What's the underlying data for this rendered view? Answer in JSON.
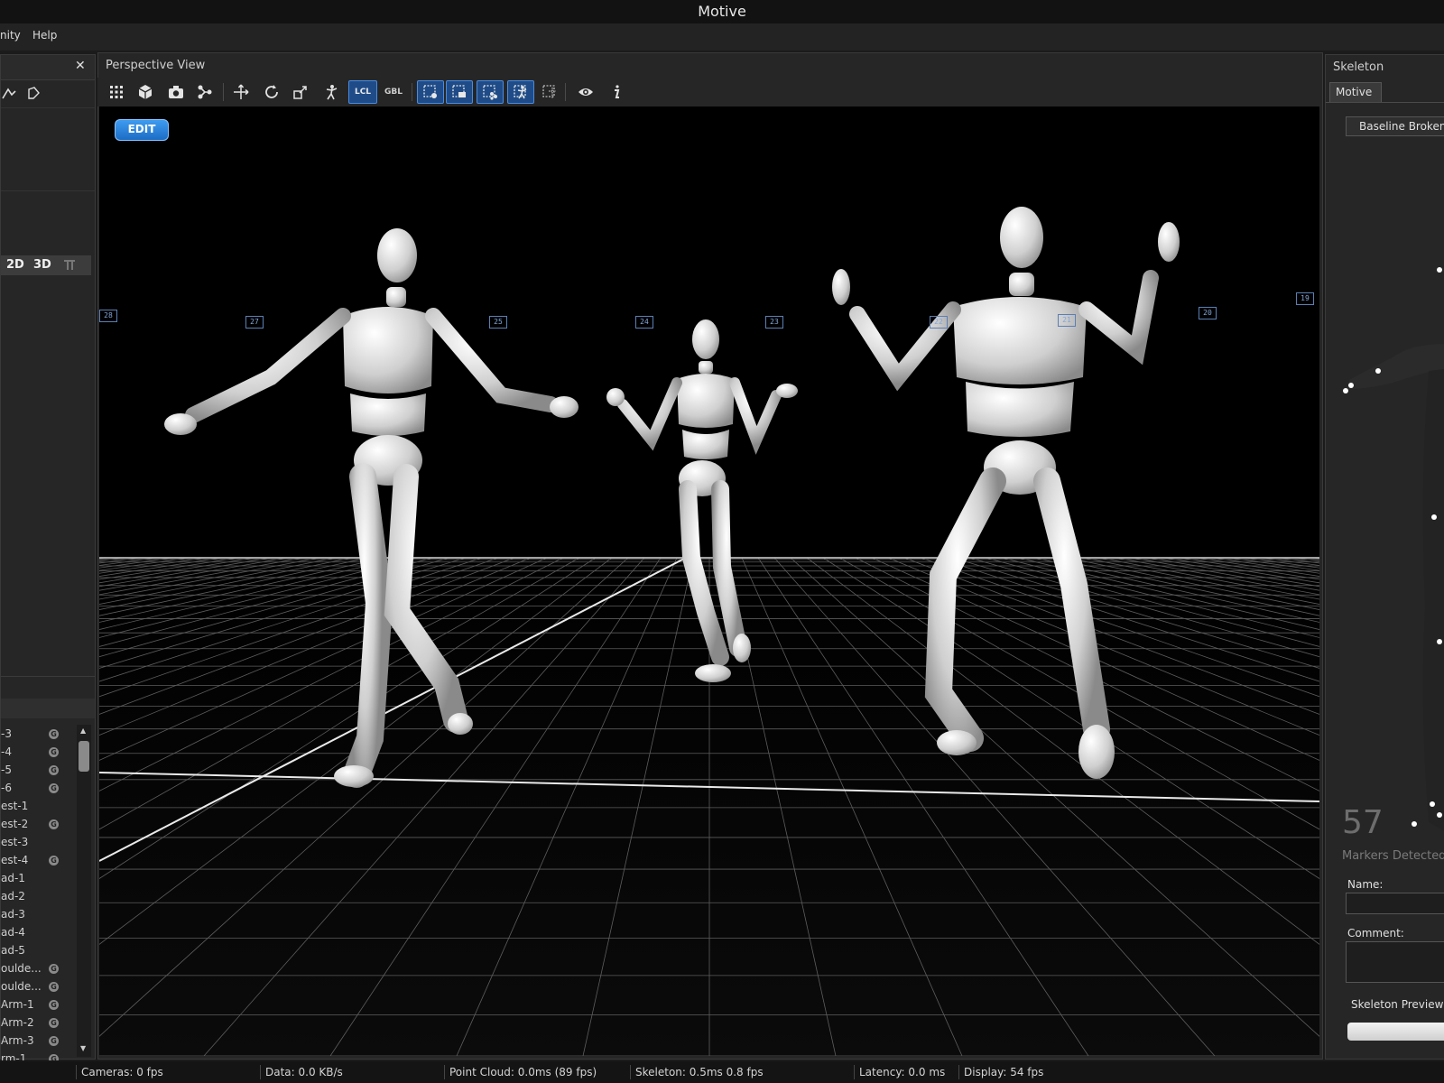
{
  "window": {
    "title": "Motive"
  },
  "menu": {
    "items": [
      "nity",
      "Help"
    ]
  },
  "left_panel": {
    "close_glyph": "✕",
    "view_toggle": {
      "mode_2d": "2D",
      "mode_3d": "3D"
    },
    "markers": [
      "-3",
      "-4",
      "-5",
      "-6",
      "est-1",
      "est-2",
      "est-3",
      "est-4",
      "ad-1",
      "ad-2",
      "ad-3",
      "ad-4",
      "ad-5",
      "oulde...",
      "oulde...",
      "Arm-1",
      "Arm-2",
      "Arm-3",
      "rm-1"
    ],
    "badge_letter": "G",
    "badge_rows": [
      0,
      1,
      2,
      3,
      5,
      7,
      13,
      14,
      15,
      16,
      17,
      18
    ]
  },
  "viewport": {
    "title": "Perspective View",
    "edit_button": "EDIT",
    "toolbar": {
      "icons": [
        "grid-icon",
        "cube-icon",
        "camera-icon",
        "skeleton-nodes-icon",
        "translate-icon",
        "rotate-icon",
        "scale-icon",
        "pose-icon",
        "local-icon",
        "global-icon",
        "select-markers-icon",
        "select-cameras-icon",
        "select-rigid-icon",
        "select-skeleton-icon",
        "select-all-icon",
        "visibility-icon",
        "info-icon"
      ],
      "lcl_label": "LCL",
      "gbl_label": "GBL",
      "active": [
        "local-icon",
        "select-markers-icon",
        "select-cameras-icon",
        "select-rigid-icon",
        "select-skeleton-icon"
      ]
    },
    "camera_labels": [
      "28",
      "27",
      "25",
      "24",
      "23",
      "22",
      "21",
      "20",
      "19"
    ]
  },
  "right_panel": {
    "title": "Skeleton",
    "tab": "Motive",
    "template_dropdown": "Baseline Broken T",
    "markers_detected_count": "57",
    "markers_detected_label": "Markers Detected",
    "name_label": "Name:",
    "comment_label": "Comment:",
    "skeleton_preview_label": "Skeleton Preview:"
  },
  "status_bar": {
    "cameras": "Cameras: 0 fps",
    "data": "Data: 0.0 KB/s",
    "point_cloud": "Point Cloud: 0.0ms (89 fps)",
    "skeleton": "Skeleton: 0.5ms 0.8 fps",
    "latency": "Latency: 0.0 ms",
    "display": "Display: 54 fps"
  },
  "colors": {
    "accent": "#2a7fd4",
    "background": "#1b1b1b",
    "viewport": "#000000"
  }
}
